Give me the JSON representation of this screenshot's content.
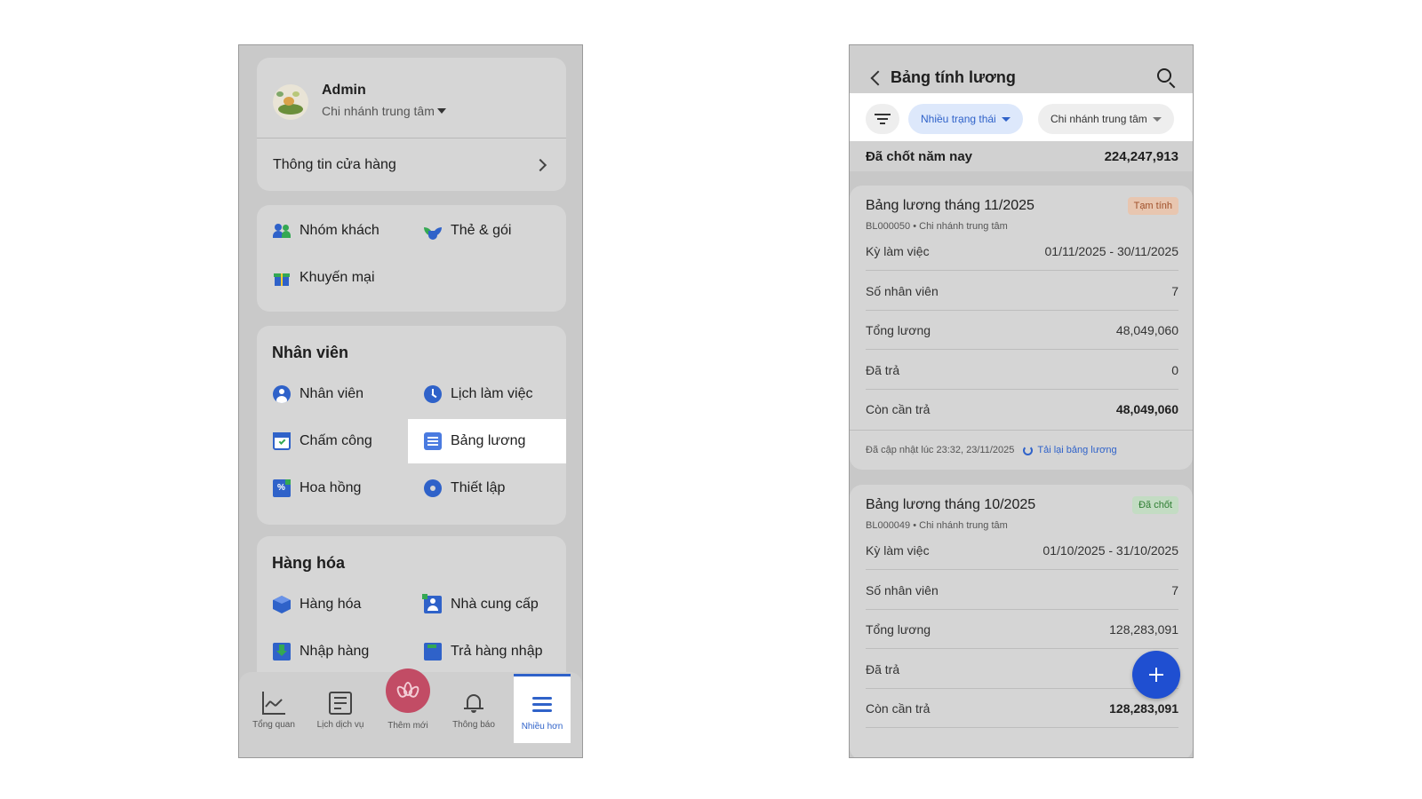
{
  "left": {
    "profile": {
      "name": "Admin",
      "branch": "Chi nhánh trung tâm",
      "store_info": "Thông tin cửa hàng"
    },
    "customer_menu": {
      "customer_groups": "Nhóm khách",
      "cards_packages": "Thẻ & gói",
      "promotions": "Khuyến mại"
    },
    "staff_section": {
      "title": "Nhân viên",
      "staff": "Nhân viên",
      "schedule": "Lịch làm việc",
      "attendance": "Chấm công",
      "payroll": "Bảng lương",
      "commission": "Hoa hồng",
      "settings": "Thiết lập"
    },
    "goods_section": {
      "title": "Hàng hóa",
      "goods": "Hàng hóa",
      "suppliers": "Nhà cung cấp",
      "import": "Nhập hàng",
      "return_import": "Trả hàng nhập"
    },
    "bottom_nav": {
      "overview": "Tổng quan",
      "service_schedule": "Lịch dịch vụ",
      "add_new": "Thêm mới",
      "notifications": "Thông báo",
      "more": "Nhiều hơn"
    }
  },
  "right": {
    "header": {
      "title": "Bảng tính lương"
    },
    "filters": {
      "status": "Nhiều trạng thái",
      "branch": "Chi nhánh trung tâm"
    },
    "summary": {
      "label": "Đã chốt năm nay",
      "value": "224,247,913"
    },
    "labels": {
      "period": "Kỳ làm việc",
      "staff_count": "Số nhân viên",
      "total": "Tổng lương",
      "paid": "Đã trả",
      "remaining": "Còn cần trả"
    },
    "payrolls": [
      {
        "title": "Bảng lương tháng 11/2025",
        "badge": "Tạm tính",
        "subtitle": "BL000050 • Chi nhánh trung tâm",
        "period": "01/11/2025 - 30/11/2025",
        "staff_count": "7",
        "total": "48,049,060",
        "paid": "0",
        "remaining": "48,049,060",
        "updated": "Đã cập nhật lúc 23:32, 23/11/2025",
        "reload": "Tải lại bảng lương"
      },
      {
        "title": "Bảng lương tháng 10/2025",
        "badge": "Đã chốt",
        "subtitle": "BL000049 • Chi nhánh trung tâm",
        "period": "01/10/2025 - 31/10/2025",
        "staff_count": "7",
        "total": "128,283,091",
        "paid": "",
        "remaining": "128,283,091"
      }
    ],
    "fab": "+"
  },
  "colors": {
    "accent": "#2f62c9",
    "fab": "#1f4fd1",
    "center_button": "#c24c65"
  }
}
